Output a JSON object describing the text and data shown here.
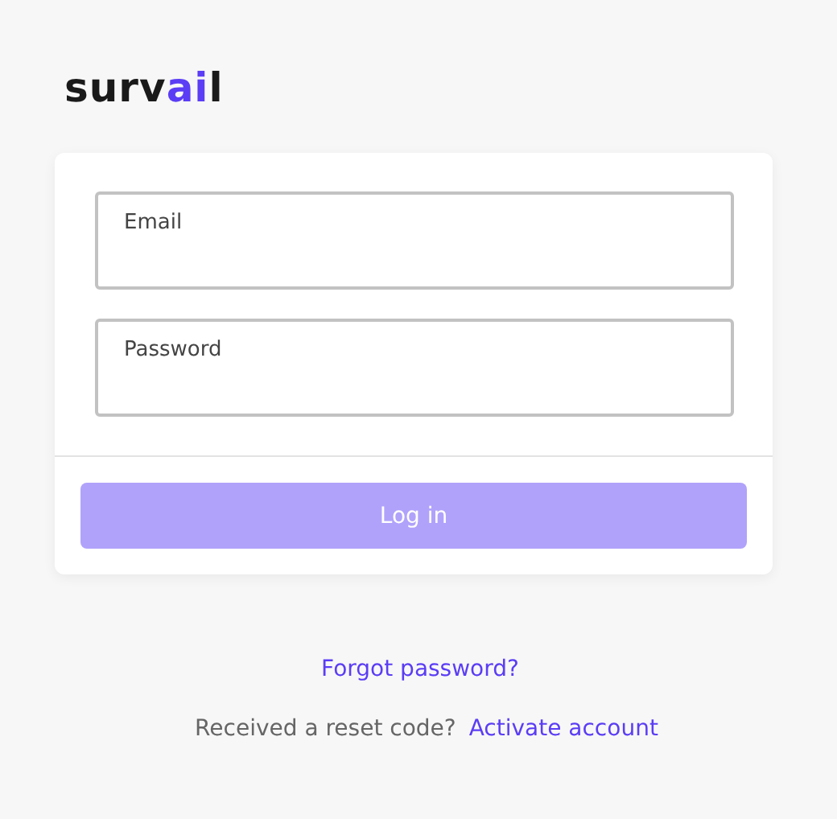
{
  "logo": {
    "parts": [
      {
        "text": "surv",
        "accent": false
      },
      {
        "text": "ai",
        "accent": true
      },
      {
        "text": "l",
        "accent": false
      }
    ]
  },
  "form": {
    "fields": [
      {
        "placeholder": "Email"
      },
      {
        "placeholder": "Password"
      }
    ],
    "submit": {
      "label": "Log in",
      "disabled": true
    }
  },
  "links": {
    "forgot": "Forgot password?",
    "reset_prompt": "Received a reset code?",
    "activate": "Activate account"
  }
}
